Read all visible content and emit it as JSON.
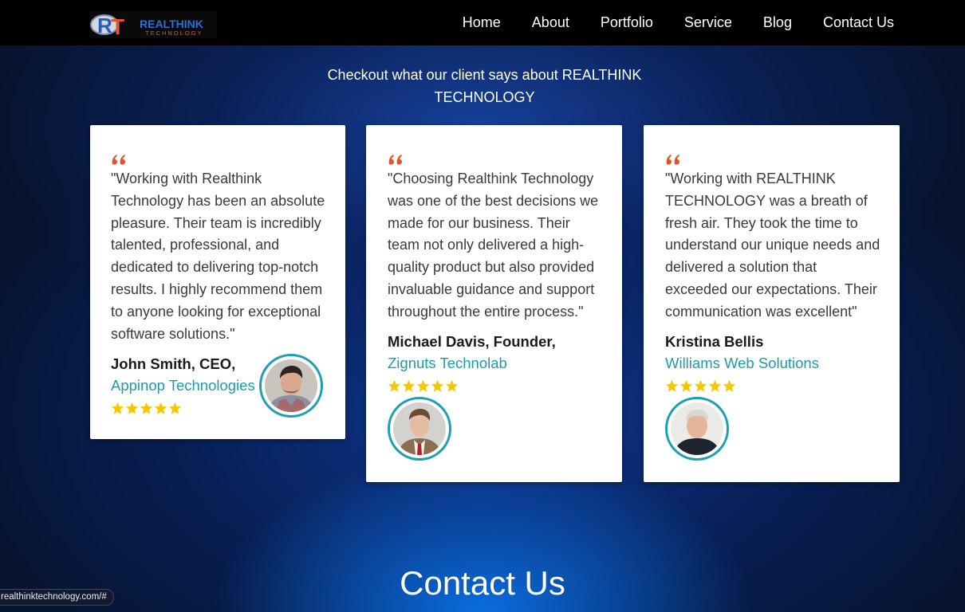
{
  "brand": {
    "name": "REALTHINK",
    "tagline": "TECHNOLOGY",
    "monogram": "RT"
  },
  "nav": [
    {
      "label": "Home"
    },
    {
      "label": "About"
    },
    {
      "label": "Portfolio"
    },
    {
      "label": "Service"
    },
    {
      "label": "Blog"
    },
    {
      "label": "Contact Us"
    }
  ],
  "testimonials_heading": "Checkout what our client says about REALTHINK TECHNOLOGY",
  "testimonials": [
    {
      "quote": "\"Working with Realthink Technology has been an absolute pleasure. Their team is incredibly talented, professional, and dedicated to delivering top-notch results. I highly recommend them to anyone looking for exceptional software solutions.\"",
      "name": "John Smith, CEO,",
      "company": "Appinop Technologies",
      "rating": 5
    },
    {
      "quote": "\"Choosing Realthink Technology was one of the best decisions we made for our business. Their team not only delivered a high-quality product but also provided invaluable guidance and support throughout the entire process.\"",
      "name": "Michael Davis, Founder,",
      "company": "Zignuts Technolab",
      "rating": 5
    },
    {
      "quote": "\"Working with REALTHINK TECHNOLOGY was a breath of fresh air. They took the time to understand our unique needs and delivered a solution that exceeded our expectations. Their communication was excellent\"",
      "name": "Kristina Bellis",
      "company": "Williams Web Solutions",
      "rating": 5
    }
  ],
  "contact_heading": "Contact Us",
  "status_url": "realthinktechnology.com/#",
  "colors": {
    "accent_quote": "#e2542a",
    "company_link": "#1b9bb0",
    "star": "#f7c600",
    "avatar_ring": "#1aa0b3"
  }
}
